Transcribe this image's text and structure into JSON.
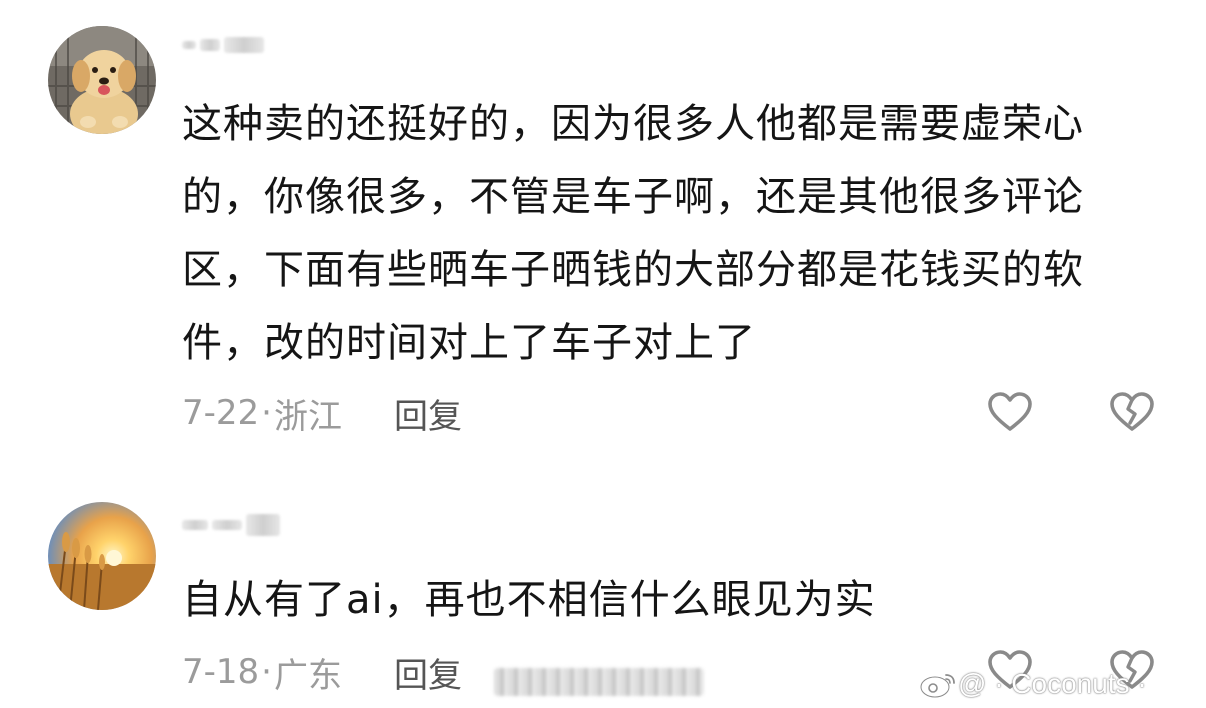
{
  "comments": [
    {
      "avatar": "golden-retriever-puppy-avatar",
      "text": "这种卖的还挺好的，因为很多人他都是需要虚荣心的，你像很多，不管是车子啊，还是其他很多评论区，下面有些晒车子晒钱的大部分都是花钱买的软件，改的时间对上了车子对上了",
      "lines": [
        "这种卖的还挺好的，因为很多人他都是需要虚荣心",
        "的，你像很多，不管是车子啊，还是其他很多评论",
        "区，下面有些晒车子晒钱的大部分都是花钱买的软",
        "件，改的时间对上了车子对上了"
      ],
      "date": "7-22",
      "location": "浙江",
      "reply_label": "回复"
    },
    {
      "avatar": "wheat-field-sunset-avatar",
      "lines": [
        "自从有了ai，再也不相信什么眼见为实"
      ],
      "date": "7-18",
      "location": "广东",
      "reply_label": "回复"
    }
  ],
  "icons": {
    "like": "heart-outline-icon",
    "dislike": "broken-heart-icon",
    "watermark_logo": "weibo-logo-icon"
  },
  "separator": "·",
  "watermark": {
    "text": "@ · Coconuts ·"
  },
  "colors": {
    "text": "#151515",
    "meta": "#9b9b9b",
    "reply": "#555555",
    "icon": "#8a8a8a"
  }
}
